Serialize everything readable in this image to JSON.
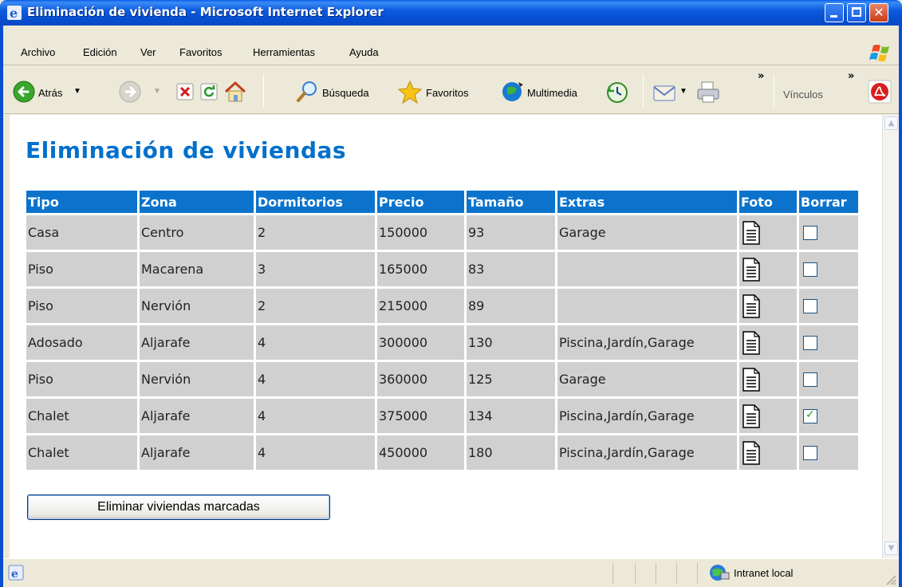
{
  "window": {
    "title": "Eliminación de vivienda - Microsoft Internet Explorer"
  },
  "menu": [
    "Archivo",
    "Edición",
    "Ver",
    "Favoritos",
    "Herramientas",
    "Ayuda"
  ],
  "toolbar": {
    "back": "Atrás",
    "search": "Búsqueda",
    "favorites": "Favoritos",
    "media": "Multimedia",
    "links": "Vínculos",
    "chevron": "»"
  },
  "page": {
    "title": "Eliminación de viviendas",
    "columns": [
      "Tipo",
      "Zona",
      "Dormitorios",
      "Precio",
      "Tamaño",
      "Extras",
      "Foto",
      "Borrar"
    ],
    "rows": [
      {
        "tipo": "Casa",
        "zona": "Centro",
        "dormitorios": "2",
        "precio": "150000",
        "tamano": "93",
        "extras": "Garage",
        "borrar": false
      },
      {
        "tipo": "Piso",
        "zona": "Macarena",
        "dormitorios": "3",
        "precio": "165000",
        "tamano": "83",
        "extras": "",
        "borrar": false
      },
      {
        "tipo": "Piso",
        "zona": "Nervión",
        "dormitorios": "2",
        "precio": "215000",
        "tamano": "89",
        "extras": "",
        "borrar": false
      },
      {
        "tipo": "Adosado",
        "zona": "Aljarafe",
        "dormitorios": "4",
        "precio": "300000",
        "tamano": "130",
        "extras": "Piscina,Jardín,Garage",
        "borrar": false
      },
      {
        "tipo": "Piso",
        "zona": "Nervión",
        "dormitorios": "4",
        "precio": "360000",
        "tamano": "125",
        "extras": "Garage",
        "borrar": false
      },
      {
        "tipo": "Chalet",
        "zona": "Aljarafe",
        "dormitorios": "4",
        "precio": "375000",
        "tamano": "134",
        "extras": "Piscina,Jardín,Garage",
        "borrar": true
      },
      {
        "tipo": "Chalet",
        "zona": "Aljarafe",
        "dormitorios": "4",
        "precio": "450000",
        "tamano": "180",
        "extras": "Piscina,Jardín,Garage",
        "borrar": false
      }
    ],
    "submit_label": "Eliminar viviendas marcadas"
  },
  "status": {
    "zone": "Intranet local"
  },
  "colors": {
    "title_blue": "#0070cc",
    "header_blue": "#0b73cc",
    "row_gray": "#d0d0d0",
    "xp_blue": "#0a4fd0"
  }
}
